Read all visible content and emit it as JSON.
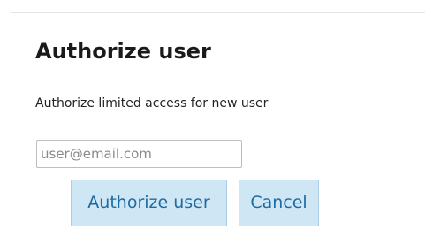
{
  "dialog": {
    "title": "Authorize user",
    "description": "Authorize limited access for new user",
    "email_input": {
      "value": "",
      "placeholder": "user@email.com"
    },
    "authorize_button_label": "Authorize user",
    "cancel_button_label": "Cancel"
  },
  "colors": {
    "button_background": "#cfe6f5",
    "button_text": "#1f6ba0",
    "title_text": "#1a1a1a"
  }
}
